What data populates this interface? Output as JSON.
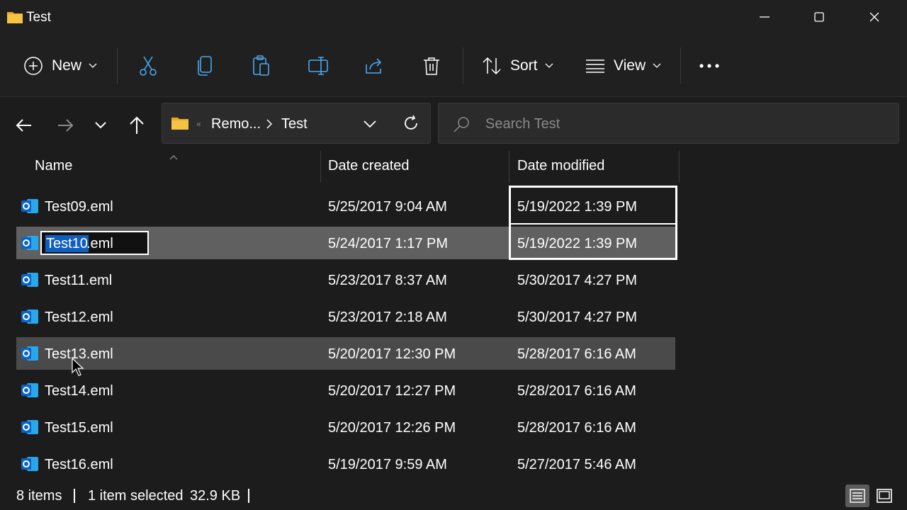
{
  "window": {
    "title": "Test",
    "minimize_icon": "minimize-icon",
    "maximize_icon": "maximize-icon",
    "close_icon": "close-icon"
  },
  "toolbar": {
    "new_label": "New",
    "sort_label": "Sort",
    "view_label": "View",
    "icons": [
      "new-plus-icon",
      "cut-icon",
      "copy-icon",
      "paste-icon",
      "rename-icon",
      "share-icon",
      "delete-icon",
      "sort-icon",
      "view-icon",
      "more-icon"
    ]
  },
  "nav": {
    "breadcrumb_parent": "Remo...",
    "breadcrumb_current": "Test",
    "search_placeholder": "Search Test"
  },
  "columns": {
    "name": "Name",
    "date_created": "Date created",
    "date_modified": "Date modified"
  },
  "files": [
    {
      "name": "Test09.eml",
      "created": "5/25/2017 9:04 AM",
      "modified": "5/19/2022 1:39 PM"
    },
    {
      "name": "Test10.eml",
      "created": "5/24/2017 1:17 PM",
      "modified": "5/19/2022 1:39 PM",
      "rename_selected": "Test10",
      "rename_rest": ".eml"
    },
    {
      "name": "Test11.eml",
      "created": "5/23/2017 8:37 AM",
      "modified": "5/30/2017 4:27 PM"
    },
    {
      "name": "Test12.eml",
      "created": "5/23/2017 2:18 AM",
      "modified": "5/30/2017 4:27 PM"
    },
    {
      "name": "Test13.eml",
      "created": "5/20/2017 12:30 PM",
      "modified": "5/28/2017 6:16 AM"
    },
    {
      "name": "Test14.eml",
      "created": "5/20/2017 12:27 PM",
      "modified": "5/28/2017 6:16 AM"
    },
    {
      "name": "Test15.eml",
      "created": "5/20/2017 12:26 PM",
      "modified": "5/28/2017 6:16 AM"
    },
    {
      "name": "Test16.eml",
      "created": "5/19/2017 9:59 AM",
      "modified": "5/27/2017 5:46 AM"
    }
  ],
  "status": {
    "items": "8 items",
    "selected": "1 item selected",
    "size": "32.9 KB"
  },
  "colors": {
    "accent": "#0e5fc0",
    "outlook_blue": "#0a64c8",
    "folder_yellow": "#f4c542"
  }
}
